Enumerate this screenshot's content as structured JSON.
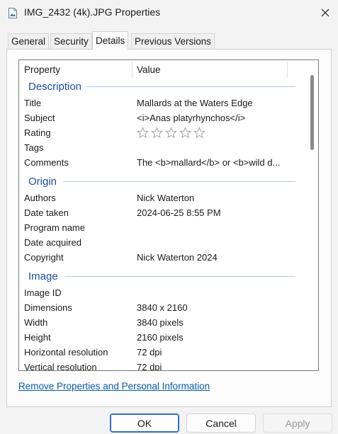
{
  "window": {
    "title": "IMG_2432 (4k).JPG Properties",
    "icon": "image-file-icon",
    "close_icon": "close-icon"
  },
  "tabs": [
    {
      "label": "General",
      "active": false
    },
    {
      "label": "Security",
      "active": false
    },
    {
      "label": "Details",
      "active": true
    },
    {
      "label": "Previous Versions",
      "active": false
    }
  ],
  "list": {
    "columns": {
      "property": "Property",
      "value": "Value"
    },
    "groups": {
      "description": {
        "label": "Description",
        "rows": [
          {
            "property": "Title",
            "value": "Mallards at the Waters Edge"
          },
          {
            "property": "Subject",
            "value": "<i>Anas platyrhynchos</i>"
          },
          {
            "property": "Rating",
            "value": ""
          },
          {
            "property": "Tags",
            "value": ""
          },
          {
            "property": "Comments",
            "value": "The <b>mallard</b> or <b>wild d..."
          }
        ],
        "rating": {
          "stars": 0,
          "max": 5,
          "icon": "star-icon"
        }
      },
      "origin": {
        "label": "Origin",
        "rows": [
          {
            "property": "Authors",
            "value": "Nick Waterton"
          },
          {
            "property": "Date taken",
            "value": "2024-06-25 8:55 PM"
          },
          {
            "property": "Program name",
            "value": ""
          },
          {
            "property": "Date acquired",
            "value": ""
          },
          {
            "property": "Copyright",
            "value": "Nick Waterton 2024"
          }
        ]
      },
      "image": {
        "label": "Image",
        "rows": [
          {
            "property": "Image ID",
            "value": ""
          },
          {
            "property": "Dimensions",
            "value": "3840 x 2160"
          },
          {
            "property": "Width",
            "value": "3840 pixels"
          },
          {
            "property": "Height",
            "value": "2160 pixels"
          },
          {
            "property": "Horizontal resolution",
            "value": "72 dpi"
          },
          {
            "property": "Vertical resolution",
            "value": "72 dpi"
          }
        ]
      }
    }
  },
  "link": "Remove Properties and Personal Information",
  "buttons": {
    "ok": "OK",
    "cancel": "Cancel",
    "apply": "Apply"
  },
  "colors": {
    "group_header": "#1f4fa0",
    "link": "#0b5cad",
    "ok_border": "#2f6fc1"
  }
}
